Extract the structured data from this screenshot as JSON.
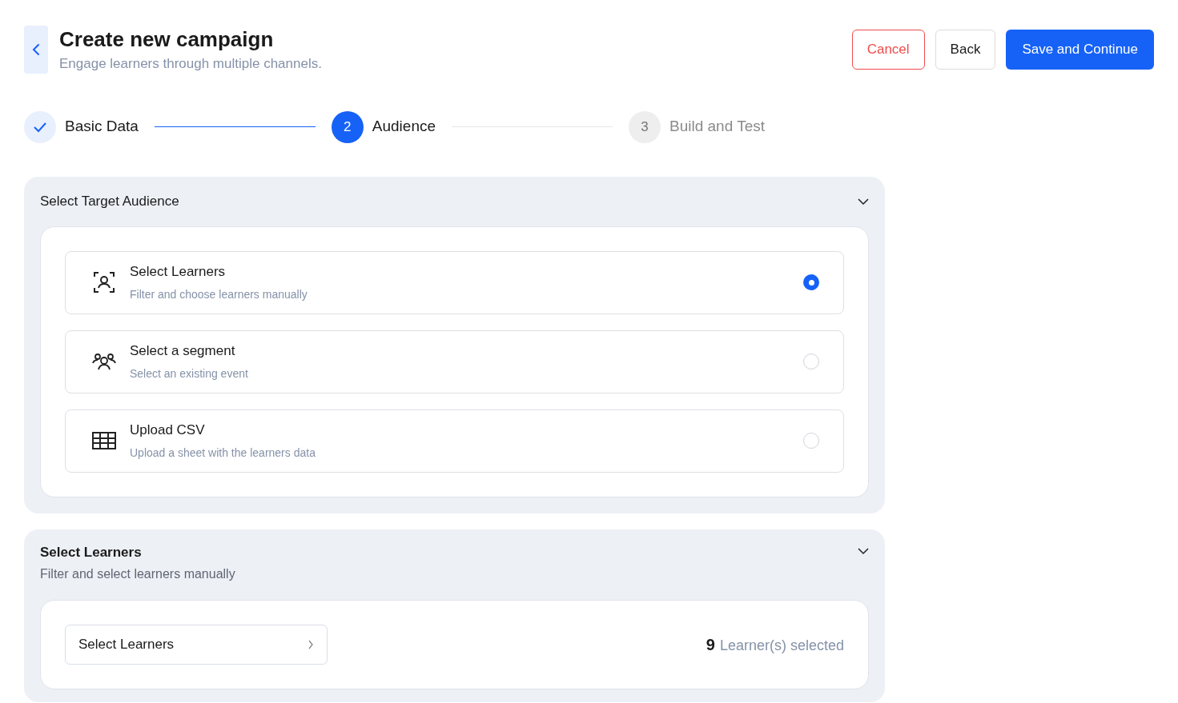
{
  "header": {
    "title": "Create new campaign",
    "subtitle": "Engage learners through multiple channels."
  },
  "actions": [
    {
      "label": "Cancel",
      "kind": "danger"
    },
    {
      "label": "Back",
      "kind": "secondary"
    },
    {
      "label": "Save and Continue",
      "kind": "primary"
    }
  ],
  "steps": [
    {
      "label": "Basic Data",
      "completed": true,
      "selected": false
    },
    {
      "marker": "2",
      "label": "Audience",
      "completed": false,
      "selected": true
    },
    {
      "marker": "3",
      "label": "Build and Test",
      "completed": false,
      "selected": false
    }
  ],
  "target_audience": {
    "title": "Select Target Audience",
    "expanded": true,
    "options": [
      {
        "kind": "learners",
        "title": "Select Learners",
        "description": "Filter and choose learners manually",
        "selected": true
      },
      {
        "kind": "segment",
        "title": "Select a segment",
        "description": "Select an existing event",
        "selected": false
      },
      {
        "kind": "csv",
        "title": "Upload CSV",
        "description": "Upload a sheet with the learners data",
        "selected": false
      }
    ]
  },
  "select_learners": {
    "title": "Select Learners",
    "subtitle": "Filter and select learners manually",
    "expanded": true,
    "button": "Select Learners",
    "count": "9",
    "count_label": "Learner(s) selected"
  }
}
